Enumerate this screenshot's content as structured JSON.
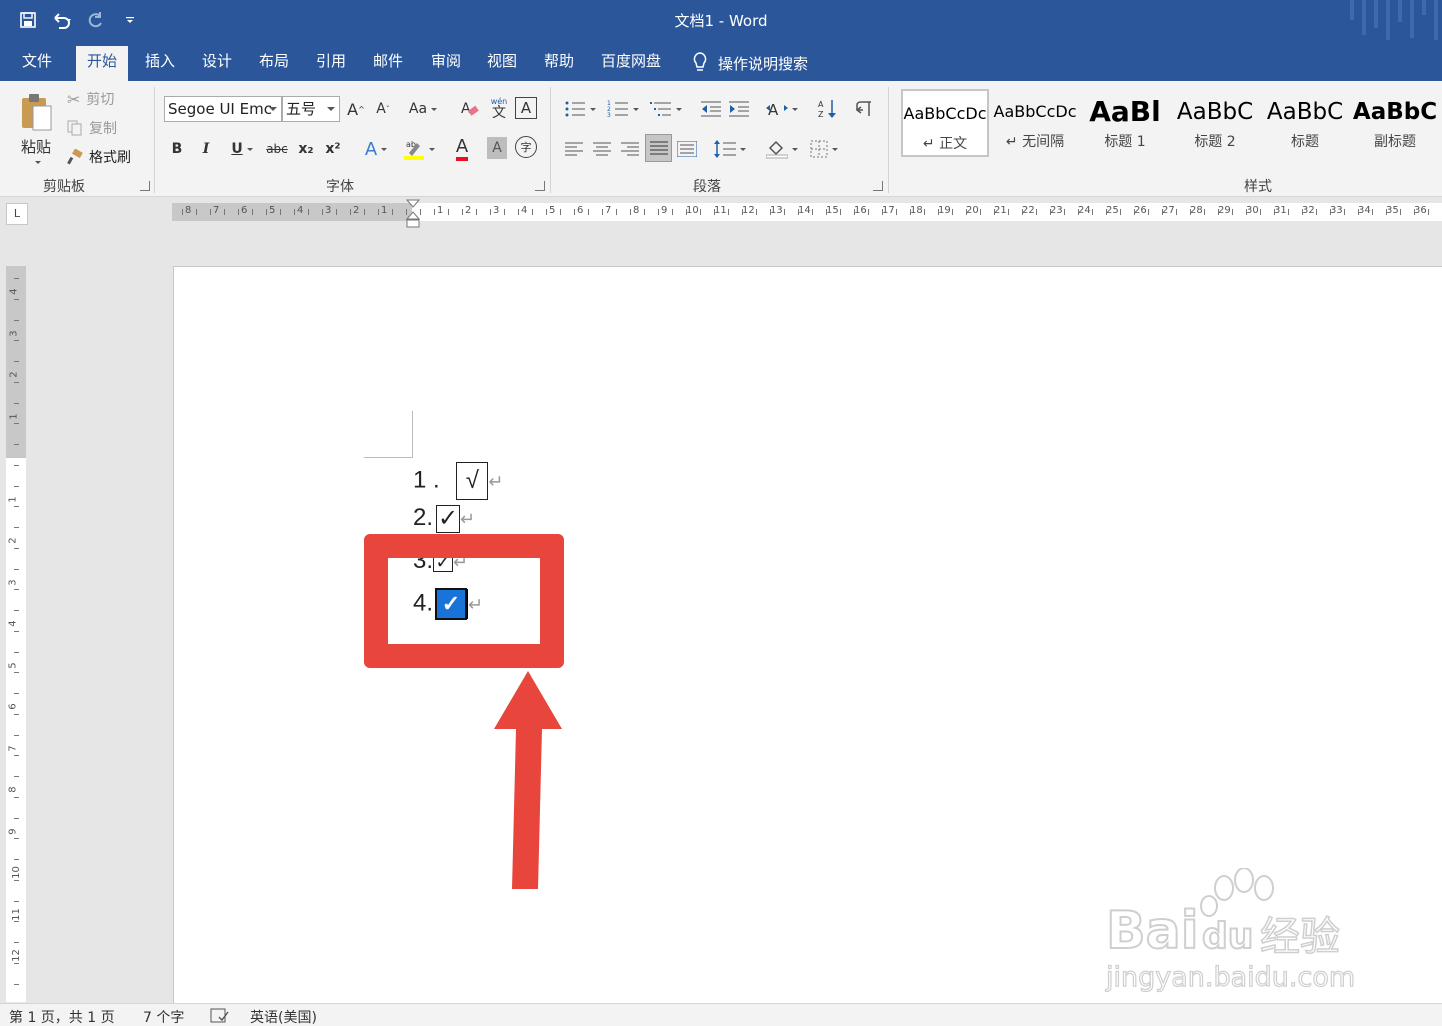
{
  "titlebar": {
    "doc_title": "文档1  -  Word",
    "qat": [
      {
        "name": "save-icon"
      },
      {
        "name": "undo-icon"
      },
      {
        "name": "redo-icon"
      },
      {
        "name": "customize-qat-icon"
      }
    ]
  },
  "tabs": [
    "文件",
    "开始",
    "插入",
    "设计",
    "布局",
    "引用",
    "邮件",
    "审阅",
    "视图",
    "帮助",
    "百度网盘"
  ],
  "active_tab": "开始",
  "tellme": {
    "label": "操作说明搜索"
  },
  "clipboard": {
    "paste": "粘贴",
    "cut": "剪切",
    "copy": "复制",
    "format_painter": "格式刷",
    "group_label": "剪贴板"
  },
  "font": {
    "font_name": "Segoe UI Emc",
    "font_size": "五号",
    "grow": "A",
    "shrink": "A",
    "change_case": "Aa",
    "bold": "B",
    "italic": "I",
    "underline": "U",
    "strikethrough": "abc",
    "subscript": "x₂",
    "superscript": "x²",
    "text_effects": "A",
    "font_color": "A",
    "char_shading": "A",
    "enclose": "字",
    "phonetic": "文",
    "phonetic_top": "wén",
    "char_border": "A",
    "group_label": "字体"
  },
  "paragraph": {
    "group_label": "段落"
  },
  "styles": {
    "group_label": "样式",
    "items": [
      {
        "sample": "AaBbCcDc",
        "name": "↵ 正文"
      },
      {
        "sample": "AaBbCcDc",
        "name": "↵ 无间隔"
      },
      {
        "sample": "AaBl",
        "name": "标题 1"
      },
      {
        "sample": "AaBbC",
        "name": "标题 2"
      },
      {
        "sample": "AaBbC",
        "name": "标题"
      },
      {
        "sample": "AaBbC",
        "name": "副标题"
      }
    ]
  },
  "ruler": {
    "tab_selector": "L",
    "left_ticks": [
      "8",
      "7",
      "6",
      "5",
      "4",
      "3",
      "2",
      "1"
    ],
    "right_ticks": [
      "1",
      "2",
      "3",
      "4",
      "5",
      "6",
      "7",
      "8",
      "9",
      "10",
      "11",
      "12",
      "13",
      "14",
      "15",
      "16",
      "17",
      "18",
      "19",
      "20",
      "21",
      "22",
      "23",
      "24",
      "25",
      "26",
      "27",
      "28",
      "29",
      "30",
      "31",
      "32",
      "33",
      "34",
      "35",
      "36"
    ],
    "v_top_ticks": [
      "4",
      "3",
      "2",
      "1"
    ],
    "v_bottom_ticks": [
      "1",
      "2",
      "3",
      "4",
      "5",
      "6",
      "7",
      "8",
      "9",
      "10",
      "11",
      "12",
      "13"
    ]
  },
  "document": {
    "list": [
      {
        "num": "1 .",
        "mark": "√"
      },
      {
        "num": "2.",
        "mark": "✓"
      },
      {
        "num": "3.",
        "mark": "✓"
      },
      {
        "num": "4.",
        "mark": "✓"
      }
    ],
    "para_mark": "↵"
  },
  "annotation": {
    "highlight_color": "#e8453c"
  },
  "statusbar": {
    "page": "第 1 页，共 1 页",
    "words": "7 个字",
    "language": "英语(美国)"
  },
  "watermark": {
    "brand": "Bai 经验",
    "url": "jingyan.baidu.com"
  },
  "colors": {
    "word_blue": "#2b579a",
    "ribbon_bg": "#f3f3f3",
    "checkbox_fill": "#1a73d9"
  }
}
